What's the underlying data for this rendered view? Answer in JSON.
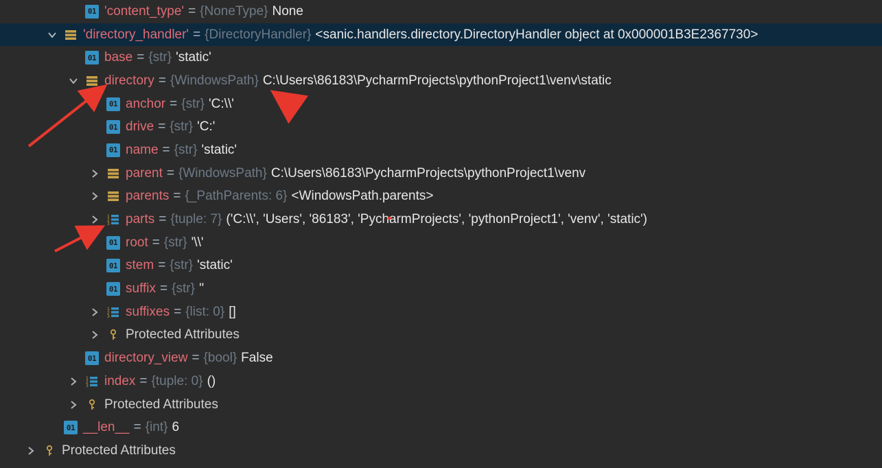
{
  "rows": [
    {
      "indent": 1,
      "expander": "none",
      "icon": "primitive",
      "name": "'content_type'",
      "eq": "=",
      "type": "{NoneType}",
      "value": "None",
      "selected": false
    },
    {
      "indent": 0,
      "expander": "expanded",
      "icon": "object",
      "name": "'directory_handler'",
      "eq": "=",
      "type": "{DirectoryHandler}",
      "value": "<sanic.handlers.directory.DirectoryHandler object at 0x000001B3E2367730>",
      "selected": true
    },
    {
      "indent": 1,
      "expander": "none",
      "icon": "primitive",
      "name": "base",
      "eq": "=",
      "type": "{str}",
      "value": "'static'",
      "selected": false
    },
    {
      "indent": 1,
      "expander": "expanded",
      "icon": "object",
      "name": "directory",
      "eq": "=",
      "type": "{WindowsPath}",
      "value": "C:\\Users\\86183\\PycharmProjects\\pythonProject1\\venv\\static",
      "selected": false
    },
    {
      "indent": 2,
      "expander": "none",
      "icon": "primitive",
      "name": "anchor",
      "eq": "=",
      "type": "{str}",
      "value": "'C:\\\\'",
      "selected": false
    },
    {
      "indent": 2,
      "expander": "none",
      "icon": "primitive",
      "name": "drive",
      "eq": "=",
      "type": "{str}",
      "value": "'C:'",
      "selected": false
    },
    {
      "indent": 2,
      "expander": "none",
      "icon": "primitive",
      "name": "name",
      "eq": "=",
      "type": "{str}",
      "value": "'static'",
      "selected": false
    },
    {
      "indent": 2,
      "expander": "collapsed",
      "icon": "object",
      "name": "parent",
      "eq": "=",
      "type": "{WindowsPath}",
      "value": "C:\\Users\\86183\\PycharmProjects\\pythonProject1\\venv",
      "selected": false
    },
    {
      "indent": 2,
      "expander": "collapsed",
      "icon": "object",
      "name": "parents",
      "eq": "=",
      "type": "{_PathParents: 6}",
      "value": "<WindowsPath.parents>",
      "selected": false
    },
    {
      "indent": 2,
      "expander": "collapsed",
      "icon": "list",
      "name": "parts",
      "eq": "=",
      "type": "{tuple: 7}",
      "value": "('C:\\\\', 'Users', '86183', 'PycharmProjects', 'pythonProject1', 'venv', 'static')",
      "selected": false
    },
    {
      "indent": 2,
      "expander": "none",
      "icon": "primitive",
      "name": "root",
      "eq": "=",
      "type": "{str}",
      "value": "'\\\\'",
      "selected": false
    },
    {
      "indent": 2,
      "expander": "none",
      "icon": "primitive",
      "name": "stem",
      "eq": "=",
      "type": "{str}",
      "value": "'static'",
      "selected": false
    },
    {
      "indent": 2,
      "expander": "none",
      "icon": "primitive",
      "name": "suffix",
      "eq": "=",
      "type": "{str}",
      "value": "''",
      "selected": false
    },
    {
      "indent": 2,
      "expander": "collapsed",
      "icon": "list",
      "name": "suffixes",
      "eq": "=",
      "type": "{list: 0}",
      "value": "[]",
      "selected": false
    },
    {
      "indent": 2,
      "expander": "collapsed",
      "icon": "key",
      "name": "",
      "eq": "",
      "type": "",
      "value": "Protected Attributes",
      "selected": false
    },
    {
      "indent": 1,
      "expander": "none",
      "icon": "primitive",
      "name": "directory_view",
      "eq": "=",
      "type": "{bool}",
      "value": "False",
      "selected": false
    },
    {
      "indent": 1,
      "expander": "collapsed",
      "icon": "list",
      "name": "index",
      "eq": "=",
      "type": "{tuple: 0}",
      "value": "()",
      "selected": false
    },
    {
      "indent": 1,
      "expander": "collapsed",
      "icon": "key",
      "name": "",
      "eq": "",
      "type": "",
      "value": "Protected Attributes",
      "selected": false
    },
    {
      "indent": 0,
      "expander": "none",
      "icon": "primitive",
      "name": "__len__",
      "eq": "=",
      "type": "{int}",
      "value": "6",
      "selected": false
    },
    {
      "indent": -1,
      "expander": "collapsed",
      "icon": "key",
      "name": "",
      "eq": "",
      "type": "",
      "value": "Protected Attributes",
      "selected": false
    }
  ],
  "icon_labels": {
    "primitive": "01"
  },
  "colors": {
    "background": "#2b2b2b",
    "selected_row": "#0d293e",
    "name": "#e06c75",
    "type": "#6e7a86",
    "value": "#e8e8e8",
    "primitive_icon": "#3592c4",
    "object_icon": "#c9a24a",
    "annotation_arrow": "#e8382e"
  }
}
